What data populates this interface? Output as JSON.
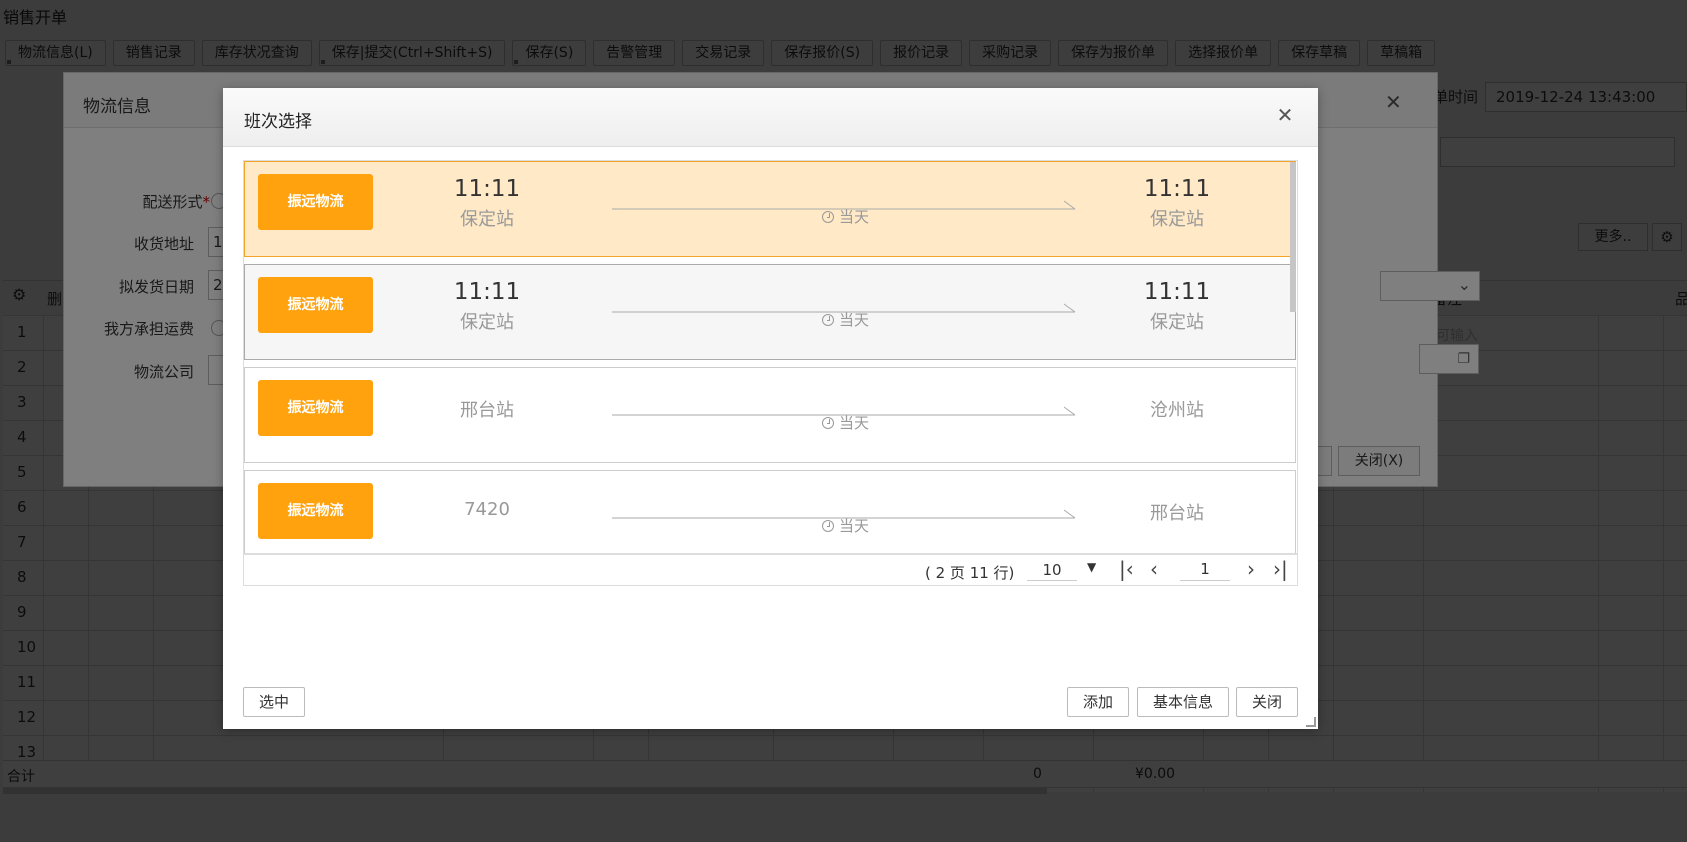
{
  "app": {
    "title": "销售开单"
  },
  "toolbar": [
    {
      "label": "物流信息(L)",
      "marked": true
    },
    {
      "label": "销售记录",
      "marked": false
    },
    {
      "label": "库存状况查询",
      "marked": false
    },
    {
      "label": "保存|提交(Ctrl+Shift+S)",
      "marked": true
    },
    {
      "label": "保存(S)",
      "marked": true
    },
    {
      "label": "告警管理",
      "marked": false
    },
    {
      "label": "交易记录",
      "marked": false
    },
    {
      "label": "保存报价(S)",
      "marked": false
    },
    {
      "label": "报价记录",
      "marked": false
    },
    {
      "label": "采购记录",
      "marked": false
    },
    {
      "label": "保存为报价单",
      "marked": false
    },
    {
      "label": "选择报价单",
      "marked": false
    },
    {
      "label": "保存草稿",
      "marked": false
    },
    {
      "label": "草稿箱",
      "marked": false
    }
  ],
  "background": {
    "date_label": "单时间",
    "date_value": "2019-12-24 13:43:00",
    "more_label": "更多..",
    "notes_header": "备注",
    "notes_placeholder": "可输入",
    "last_col_header": "品",
    "first_col_header": "删",
    "row_numbers": [
      "1",
      "2",
      "3",
      "4",
      "5",
      "6",
      "7",
      "8",
      "9",
      "10",
      "11",
      "12",
      "13"
    ],
    "summary_label": "合计",
    "summary_qty": "0",
    "summary_amount": "¥0.00"
  },
  "logistics_dialog": {
    "title": "物流信息",
    "fields": [
      {
        "label": "配送形式",
        "required": true
      },
      {
        "label": "收货地址",
        "value": "1"
      },
      {
        "label": "拟发货日期",
        "value": "2"
      },
      {
        "label": "我方承担运费"
      },
      {
        "label": "物流公司"
      }
    ],
    "close_label": "关闭(X)"
  },
  "shift_dialog": {
    "title": "班次选择",
    "cards": [
      {
        "company": "振远物流",
        "dep_time": "11:11",
        "dep_station": "保定站",
        "arr_time": "11:11",
        "arr_station": "保定站",
        "duration": "当天",
        "state": "selected"
      },
      {
        "company": "振远物流",
        "dep_time": "11:11",
        "dep_station": "保定站",
        "arr_time": "11:11",
        "arr_station": "保定站",
        "duration": "当天",
        "state": "hover"
      },
      {
        "company": "振远物流",
        "dep_time": "",
        "dep_station": "邢台站",
        "arr_time": "",
        "arr_station": "沧州站",
        "duration": "当天",
        "state": "normal"
      },
      {
        "company": "振远物流",
        "dep_time": "",
        "dep_station": "7420",
        "arr_time": "",
        "arr_station": "邢台站",
        "duration": "当天",
        "state": "normal"
      }
    ],
    "pager": {
      "info": "( 2 页 11 行)",
      "page_size": "10",
      "current_page": "1"
    },
    "buttons": {
      "select": "选中",
      "add": "添加",
      "basic_info": "基本信息",
      "close": "关闭"
    }
  }
}
